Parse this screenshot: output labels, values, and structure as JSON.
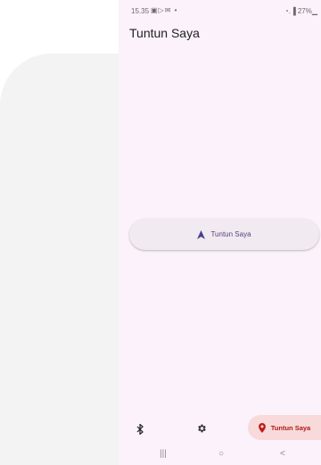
{
  "status_bar": {
    "time": "15.35",
    "notifications": "▣▷✉ •",
    "signal_battery": "◔.▐ 27%▁"
  },
  "app": {
    "title": "Tuntun Saya"
  },
  "main": {
    "follow_button_label": "Tuntun Saya",
    "follow_button_icon": "navigation-arrow-icon",
    "follow_button_color": "#5a3d80"
  },
  "bottom_bar": {
    "bluetooth_icon": "bluetooth-icon",
    "settings_icon": "gear-icon",
    "follow_label": "Tuntun Saya",
    "follow_icon": "location-pin-icon",
    "follow_bg_color": "#f8dada",
    "follow_text_color": "#b01818"
  },
  "nav_bar": {
    "recents": "|||",
    "home": "○",
    "back": "<"
  }
}
